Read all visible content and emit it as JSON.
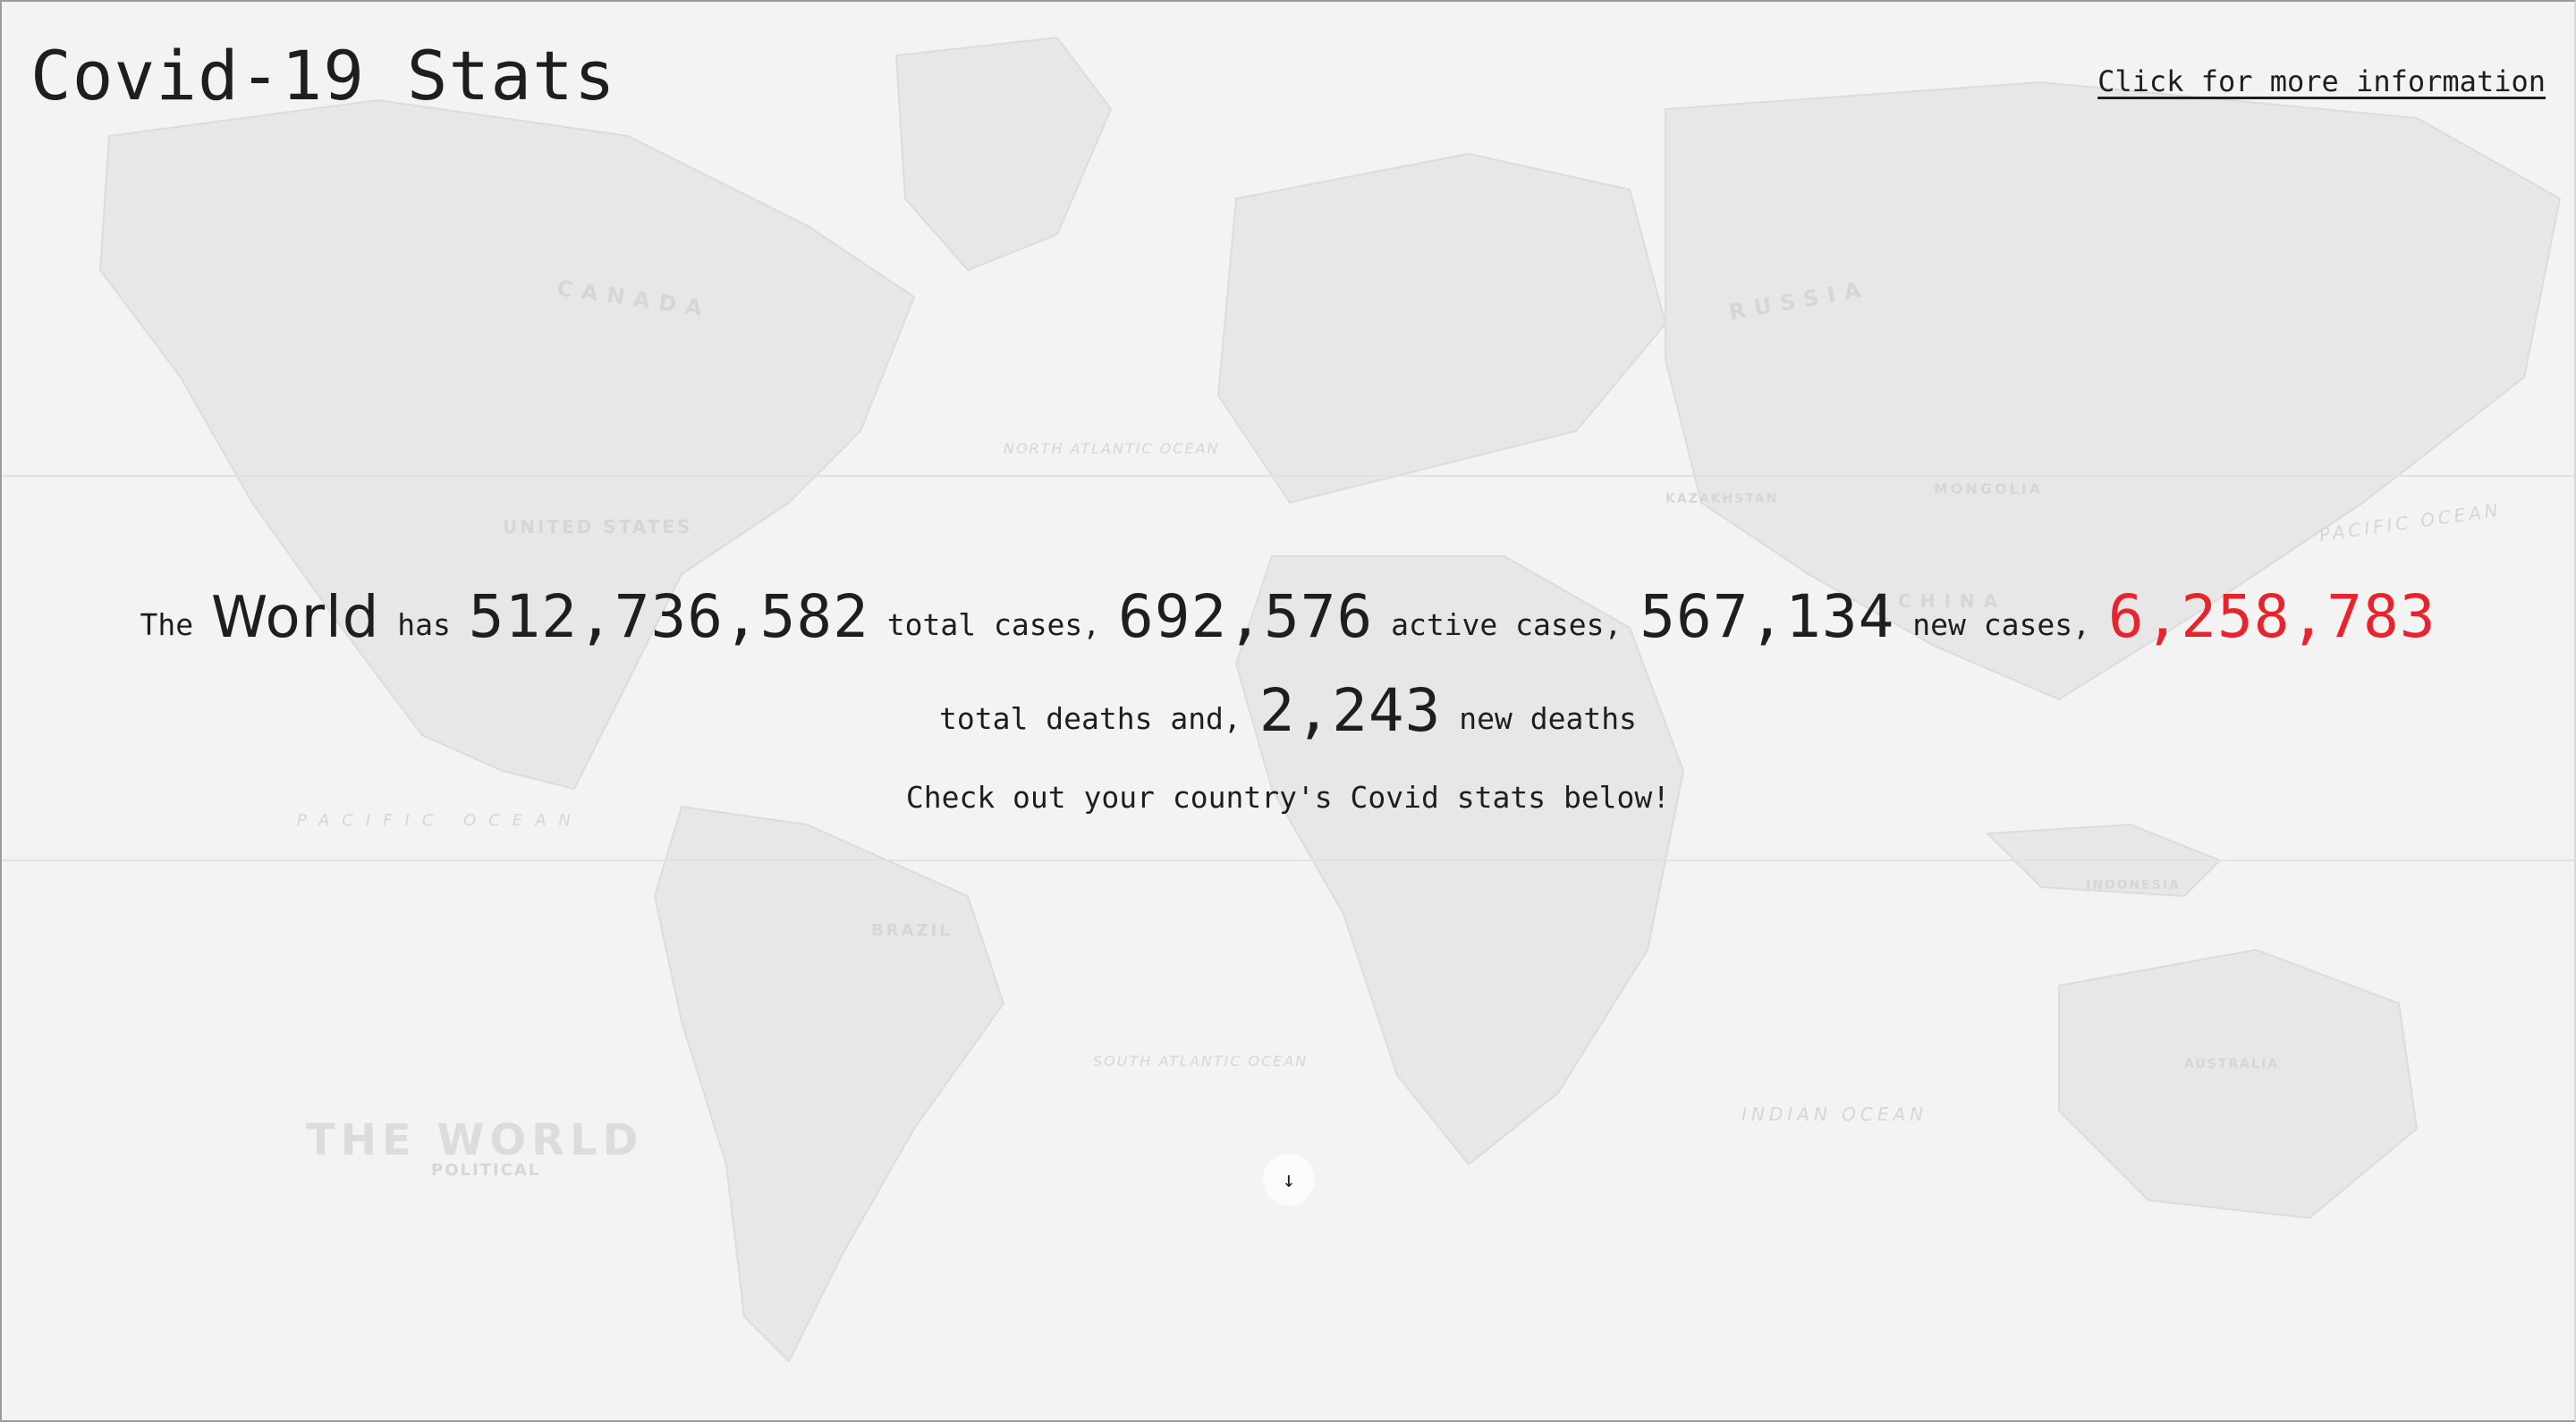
{
  "header": {
    "title": "Covid-19 Stats",
    "more_info_link": "Click for more information"
  },
  "summary": {
    "the": "The",
    "region": "World",
    "has": "has",
    "total_cases": "512,736,582",
    "total_cases_label": "total cases,",
    "active_cases": "692,576",
    "active_cases_label": "active cases,",
    "new_cases": "567,134",
    "new_cases_label": "new cases,",
    "total_deaths": "6,258,783",
    "total_deaths_label": "total deaths and,",
    "new_deaths": "2,243",
    "new_deaths_label": "new deaths"
  },
  "prompt": "Check out your country's Covid stats below!",
  "scroll_down": {
    "icon": "arrow-down-icon",
    "glyph": "↓"
  },
  "map": {
    "labels": {
      "canada": "CANADA",
      "russia": "RUSSIA",
      "china": "CHINA",
      "brazil": "BRAZIL",
      "united_states": "UNITED STATES",
      "north_atlantic": "NORTH ATLANTIC OCEAN",
      "south_atlantic": "SOUTH ATLANTIC OCEAN",
      "pacific_left": "PACIFIC OCEAN",
      "pacific_right": "PACIFIC OCEAN",
      "indian": "INDIAN OCEAN",
      "kazakhstan": "KAZAKHSTAN",
      "mongolia": "MONGOLIA",
      "australia": "AUSTRALIA",
      "indonesia": "INDONESIA",
      "the_world": "THE WORLD",
      "political": "POLITICAL"
    }
  },
  "colors": {
    "deaths": "#e8232b",
    "text": "#1e1e1e",
    "background": "#f3f3f3"
  }
}
